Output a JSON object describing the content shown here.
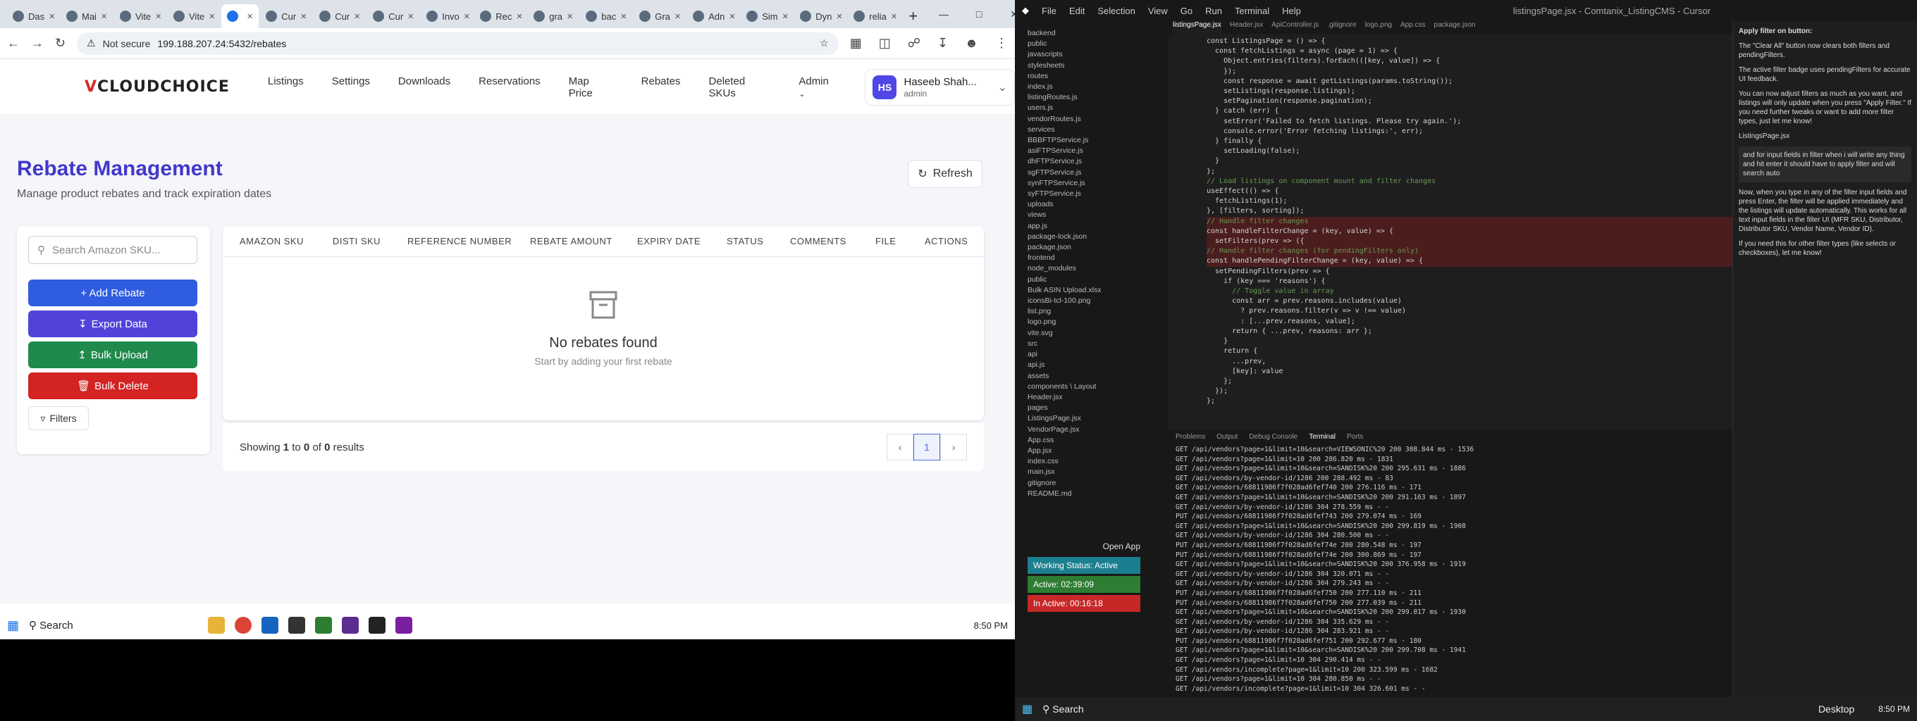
{
  "browser": {
    "tabs": [
      "Das",
      "Mai",
      "Vite",
      "Vite",
      "",
      "Cur",
      "Cur",
      "Cur",
      "Invo",
      "Rec",
      "gra",
      "bac",
      "Gra",
      "Adn",
      "Sim",
      "Dyn",
      "relia"
    ],
    "address_security": "Not secure",
    "url": "199.188.207.24:5432/rebates"
  },
  "app": {
    "logo_v": "V",
    "logo_rest": "CLOUDCHOICE",
    "nav": [
      "Listings",
      "Settings",
      "Downloads",
      "Reservations",
      "Map Price",
      "Rebates",
      "Deleted SKUs",
      "Admin"
    ],
    "user": {
      "initials": "HS",
      "name": "Haseeb Shah...",
      "role": "admin"
    },
    "page_title": "Rebate Management",
    "page_subtitle": "Manage product rebates and track expiration dates",
    "refresh_label": "Refresh",
    "search_placeholder": "Search Amazon SKU...",
    "buttons": {
      "add": "+ Add Rebate",
      "export": "Export Data",
      "bulk_upload": "Bulk Upload",
      "bulk_delete": "Bulk Delete",
      "filters": "Filters"
    },
    "colors": {
      "add": "#2f5ce0",
      "export": "#5143d9",
      "bulk_upload": "#1f8a4c",
      "bulk_delete": "#d32323",
      "title": "#4338ca"
    },
    "columns": [
      "AMAZON SKU",
      "DISTI SKU",
      "REFERENCE NUMBER",
      "REBATE AMOUNT",
      "EXPIRY DATE",
      "STATUS",
      "COMMENTS",
      "FILE",
      "ACTIONS"
    ],
    "empty_title": "No rebates found",
    "empty_sub": "Start by adding your first rebate",
    "showing": {
      "prefix": "Showing",
      "from": "1",
      "to_word": "to",
      "to": "0",
      "of_word": "of",
      "total": "0",
      "suffix": "results"
    },
    "page": "1"
  },
  "taskbar_left": {
    "search": "Search",
    "time": "8:50 PM"
  },
  "cursor": {
    "menu": [
      "File",
      "Edit",
      "Selection",
      "View",
      "Go",
      "Run",
      "Terminal",
      "Help"
    ],
    "title": "listingsPage.jsx - Comtanix_ListingCMS - Cursor",
    "tabs": [
      "listingsPage.jsx",
      "Header.jsx",
      "ApiController.js",
      ".gitignore",
      "logo.png",
      "App.css",
      "package.json"
    ],
    "explorer": [
      "backend",
      "public",
      "javascripts",
      "stylesheets",
      "routes",
      "index.js",
      "listingRoutes.js",
      "users.js",
      "vendorRoutes.js",
      "services",
      "BBBFTPService.js",
      "asiFTPService.js",
      "dhFTPService.js",
      "sgFTPService.js",
      "synFTPService.js",
      "syFTPService.js",
      "uploads",
      "views",
      "app.js",
      "package-lock.json",
      "package.json",
      "frontend",
      "node_modules",
      "public",
      "Bulk ASIN Upload.xlsx",
      "iconsBi-tcl-100.png",
      "list.png",
      "logo.png",
      "vite.svg",
      "src",
      "api",
      "api.js",
      "assets",
      "components \\ Layout",
      "Header.jsx",
      "pages",
      "ListingsPage.jsx",
      "VendorPage.jsx",
      "App.css",
      "App.jsx",
      "index.css",
      "main.jsx",
      "gitignore",
      "README.md"
    ],
    "code": [
      "const ListingsPage = () => {",
      "  const fetchListings = async (page = 1) => {",
      "    Object.entries(filters).forEach(([key, value]) => {",
      "    });",
      "",
      "    const response = await getListings(params.toString());",
      "",
      "    setListings(response.listings);",
      "    setPagination(response.pagination);",
      "  } catch (err) {",
      "    setError('Failed to fetch listings. Please try again.');",
      "    console.error('Error fetching listings:', err);",
      "  } finally {",
      "    setLoading(false);",
      "  }",
      "};",
      "",
      "// Load listings on component mount and filter changes",
      "useEffect(() => {",
      "  fetchListings(1);",
      "}, [filters, sorting]);",
      "",
      "// Handle filter changes",
      "const handleFilterChange = (key, value) => {",
      "  setFilters(prev => ({",
      "// Handle filter changes (for pendingFilters only)",
      "const handlePendingFilterChange = (key, value) => {",
      "  setPendingFilters(prev => {",
      "    if (key === 'reasons') {",
      "      // Toggle value in array",
      "      const arr = prev.reasons.includes(value)",
      "        ? prev.reasons.filter(v => v !== value)",
      "        : [...prev.reasons, value];",
      "      return { ...prev, reasons: arr };",
      "    }",
      "    return {",
      "      ...prev,",
      "      [key]: value",
      "    };",
      "  });",
      "};"
    ],
    "terminal_tabs": [
      "Problems",
      "Output",
      "Debug Console",
      "Terminal",
      "Ports"
    ],
    "terminal": [
      "GET /api/vendors?page=1&limit=10&search=VIEWSONIC%20 200 308.844 ms - 1536",
      "GET /api/vendors?page=1&limit=10 200 286.820 ms - 1831",
      "GET /api/vendors?page=1&limit=10&search=SANDISK%20 200 295.631 ms - 1886",
      "GET /api/vendors/by-vendor-id/1286 200 288.492 ms - 83",
      "GET /api/vendors/68811986f7f028ad6fef740 200 276.116 ms - 171",
      "GET /api/vendors?page=1&limit=10&search=SANDISK%20 200 291.163 ms - 1897",
      "GET /api/vendors/by-vendor-id/1286 304 278.559 ms - -",
      "PUT /api/vendors/68811986f7f028ad6fef743 200 279.074 ms - 169",
      "GET /api/vendors?page=1&limit=10&search=SANDISK%20 200 299.819 ms - 1908",
      "GET /api/vendors/by-vendor-id/1286 304 280.500 ms - -",
      "PUT /api/vendors/68811986f7f028ad6fef74e 200 280.548 ms - 197",
      "PUT /api/vendors/68811986f7f028ad6fef74e 200 300.869 ms - 197",
      "GET /api/vendors?page=1&limit=10&search=SANDISK%20 200 376.958 ms - 1919",
      "GET /api/vendors/by-vendor-id/1286 304 320.071 ms - -",
      "GET /api/vendors/by-vendor-id/1286 304 279.243 ms - -",
      "PUT /api/vendors/68811986f7f028ad6fef750 200 277.110 ms - 211",
      "PUT /api/vendors/68811986f7f028ad6fef750 200 277.039 ms - 211",
      "GET /api/vendors?page=1&limit=10&search=SANDISK%20 200 299.017 ms - 1930",
      "GET /api/vendors/by-vendor-id/1286 304 335.629 ms - -",
      "GET /api/vendors/by-vendor-id/1286 304 283.921 ms - -",
      "PUT /api/vendors/68811986f7f028ad6fef751 200 292.677 ms - 180",
      "GET /api/vendors?page=1&limit=10&search=SANDISK%20 200 299.708 ms - 1941",
      "GET /api/vendors?page=1&limit=10 304 290.414 ms - -",
      "GET /api/vendors/incomplete?page=1&limit=10 200 323.599 ms - 1682",
      "GET /api/vendors?page=1&limit=10 304 280.850 ms - -",
      "GET /api/vendors/incomplete?page=1&limit=10 304 326.601 ms - -"
    ],
    "chat": [
      "Apply filter on button:",
      "The \"Clear All\" button now clears both filters and pendingFilters.",
      "The active filter badge uses pendingFilters for accurate UI feedback.",
      "You can now adjust filters as much as you want, and listings will only update when you press \"Apply Filter.\" If you need further tweaks or want to add more filter types, just let me know!",
      "ListingsPage.jsx",
      "and for input fields in filter when i will write any thing and hit enter it should have to apply filter and will search auto",
      "Now, when you type in any of the filter input fields and press Enter, the filter will be applied immediately and the listings will update automatically. This works for all text input fields in the filter UI (MFR SKU, Distributor, Distributor SKU, Vendor Name, Vendor ID).",
      "If you need this for other filter types (like selects or checkboxes), let me know!"
    ],
    "work_panel": {
      "open_app": "Open App",
      "status": "Working Status: Active",
      "active": "Active: 02:39:09",
      "inactive": "In Active: 00:16:18"
    },
    "taskbar": {
      "search": "Search",
      "desktop": "Desktop",
      "time": "8:50 PM"
    }
  }
}
